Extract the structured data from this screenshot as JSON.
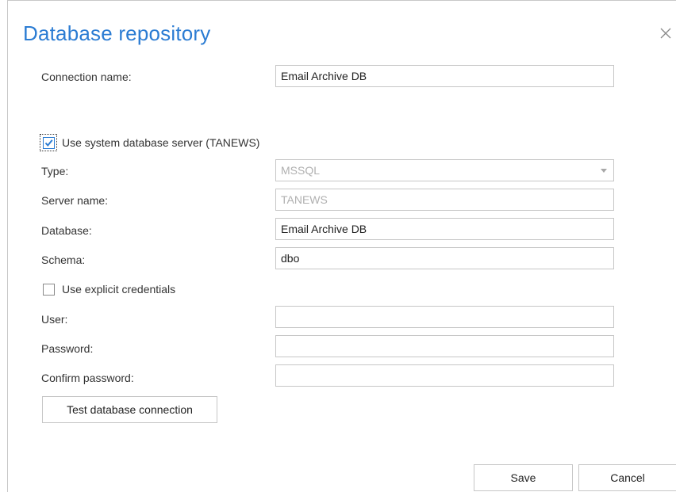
{
  "dialog": {
    "title": "Database repository",
    "close_icon": "close-icon"
  },
  "form": {
    "connection_name": {
      "label": "Connection name:",
      "value": "Email Archive DB"
    },
    "use_system_server": {
      "label": "Use system database server (TANEWS)",
      "checked": true
    },
    "type": {
      "label": "Type:",
      "value": "MSSQL"
    },
    "server_name": {
      "label": "Server name:",
      "value": "TANEWS"
    },
    "database": {
      "label": "Database:",
      "value": "Email Archive DB"
    },
    "schema": {
      "label": "Schema:",
      "value": "dbo"
    },
    "use_explicit_credentials": {
      "label": "Use explicit credentials",
      "checked": false
    },
    "user": {
      "label": "User:",
      "value": ""
    },
    "password": {
      "label": "Password:",
      "value": ""
    },
    "confirm_password": {
      "label": "Confirm password:",
      "value": ""
    },
    "test_button": "Test database connection"
  },
  "footer": {
    "save_label": "Save",
    "cancel_label": "Cancel"
  },
  "colors": {
    "accent": "#2b7cd3",
    "border": "#c6c6c6",
    "disabled_text": "#b0b0b0"
  }
}
